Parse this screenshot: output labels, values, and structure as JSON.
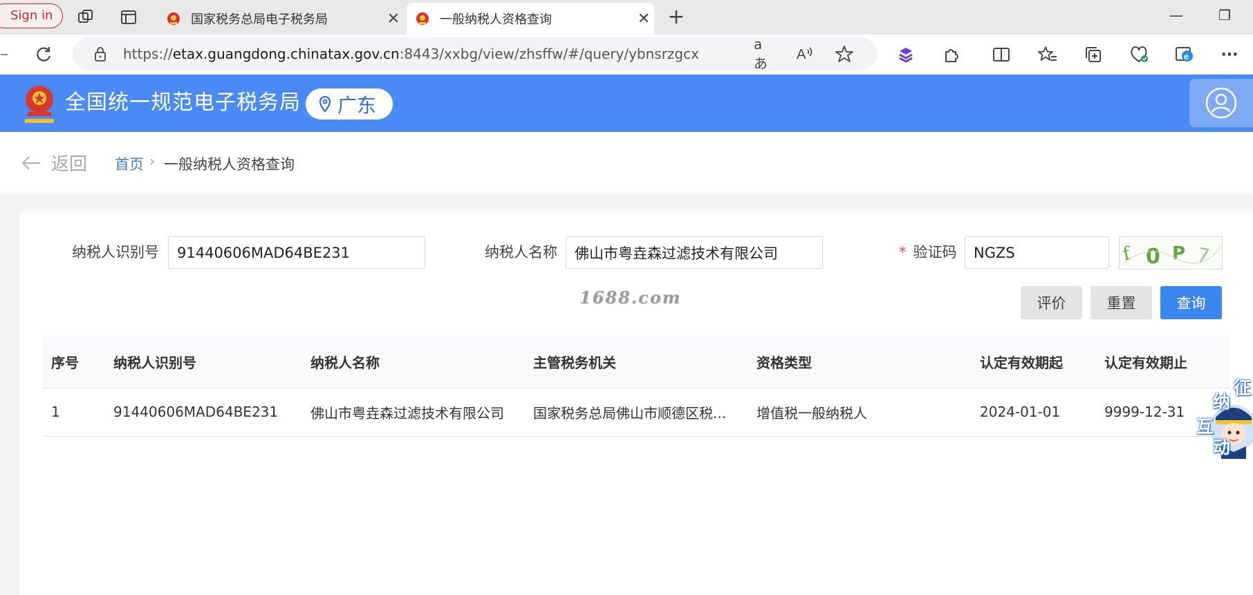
{
  "browser": {
    "signin_label": "Sign in",
    "tabs": [
      {
        "title": "国家税务总局电子税务局",
        "active": false
      },
      {
        "title": "一般纳税人资格查询",
        "active": true
      }
    ],
    "close_glyph": "✕",
    "new_tab_glyph": "+",
    "minimize_glyph": "—",
    "restore_glyph": "❐",
    "url_prefix": "https://",
    "url_host": "etax.guangdong.chinatax.gov.cn",
    "url_rest": ":8443/xxbg/view/zhsffw/#/query/ybnsrzgcx",
    "read_aloud_label": "aあ",
    "more_glyph": "···"
  },
  "site": {
    "title": "全国统一规范电子税务局",
    "region": "广东"
  },
  "breadcrumb": {
    "back_label": "返回",
    "home": "首页",
    "separator": "›",
    "current": "一般纳税人资格查询"
  },
  "form": {
    "taxpayer_id_label": "纳税人识别号",
    "taxpayer_id_value": "91440606MAD64BE231",
    "taxpayer_name_label": "纳税人名称",
    "taxpayer_name_value": "佛山市粤垚森过滤技术有限公司",
    "captcha_required_mark": "*",
    "captcha_label": "验证码",
    "captcha_value": "NGZS",
    "captcha_image_text": "f0P7"
  },
  "buttons": {
    "evaluate": "评价",
    "reset": "重置",
    "query": "查询"
  },
  "watermark": "1688.com",
  "table": {
    "headers": [
      "序号",
      "纳税人识别号",
      "纳税人名称",
      "主管税务机关",
      "资格类型",
      "认定有效期起",
      "认定有效期止"
    ],
    "rows": [
      [
        "1",
        "91440606MAD64BE231",
        "佛山市粤垚森过滤技术有限公司",
        "国家税务总局佛山市顺德区税...",
        "增值税一般纳税人",
        "2024-01-01",
        "9999-12-31"
      ]
    ]
  },
  "helper": {
    "chars": [
      "征",
      "纳",
      "互",
      "动"
    ]
  },
  "colors": {
    "header_blue": "#4a8af4",
    "button_blue": "#3c86f0",
    "required_red": "#e84a4a",
    "signin_red": "#c52a2a"
  }
}
